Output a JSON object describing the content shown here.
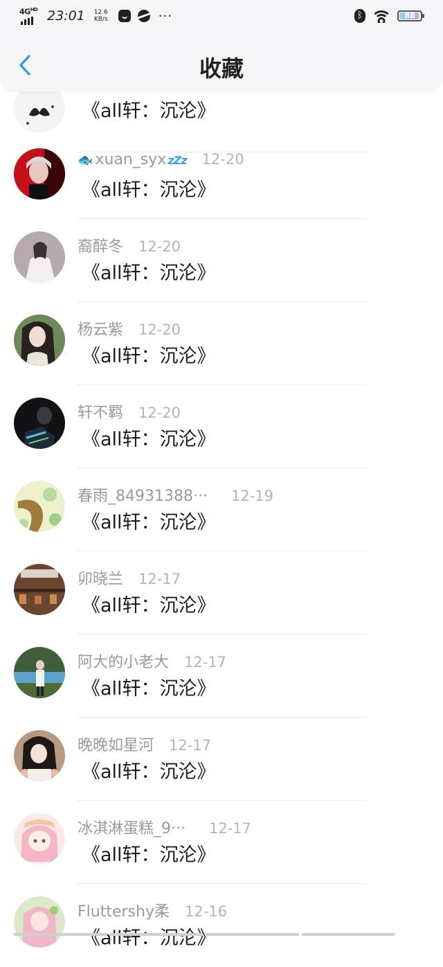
{
  "status_bar": {
    "network": "4G",
    "network_sup": "HD",
    "time": "23:01",
    "speed_value": "12.6",
    "speed_unit": "KB/s",
    "more": "···",
    "battery_level": "88"
  },
  "header": {
    "title": "收藏",
    "back_icon": "chevron-left-icon"
  },
  "items": [
    {
      "name": "",
      "date": "",
      "post": "《all轩：沉沦》"
    },
    {
      "name": "xuan_syx",
      "date": "12-20",
      "post": "《all轩：沉沦》"
    },
    {
      "name": "裔醉冬",
      "date": "12-20",
      "post": "《all轩：沉沦》"
    },
    {
      "name": "杨云紫",
      "date": "12-20",
      "post": "《all轩：沉沦》"
    },
    {
      "name": "轩不羁",
      "date": "12-20",
      "post": "《all轩：沉沦》"
    },
    {
      "name": "春雨_84931388···",
      "date": "12-19",
      "post": "《all轩：沉沦》"
    },
    {
      "name": "卯晓兰",
      "date": "12-17",
      "post": "《all轩：沉沦》"
    },
    {
      "name": "阿大的小老大",
      "date": "12-17",
      "post": "《all轩：沉沦》"
    },
    {
      "name": "晚晚如星河",
      "date": "12-17",
      "post": "《all轩：沉沦》"
    },
    {
      "name": "冰淇淋蛋糕_9···",
      "date": "12-17",
      "post": "《all轩：沉沦》"
    },
    {
      "name": "Fluttershy柔",
      "date": "12-16",
      "post": "《all轩：沉沦》"
    }
  ],
  "decor": {
    "fish": "🐟",
    "zzz": "zZz"
  },
  "colors": {
    "accent": "#2f9be3",
    "meta_text": "#9a9a9a",
    "post_text": "#1c1c1c",
    "header_bg": "#f5f5f7"
  }
}
